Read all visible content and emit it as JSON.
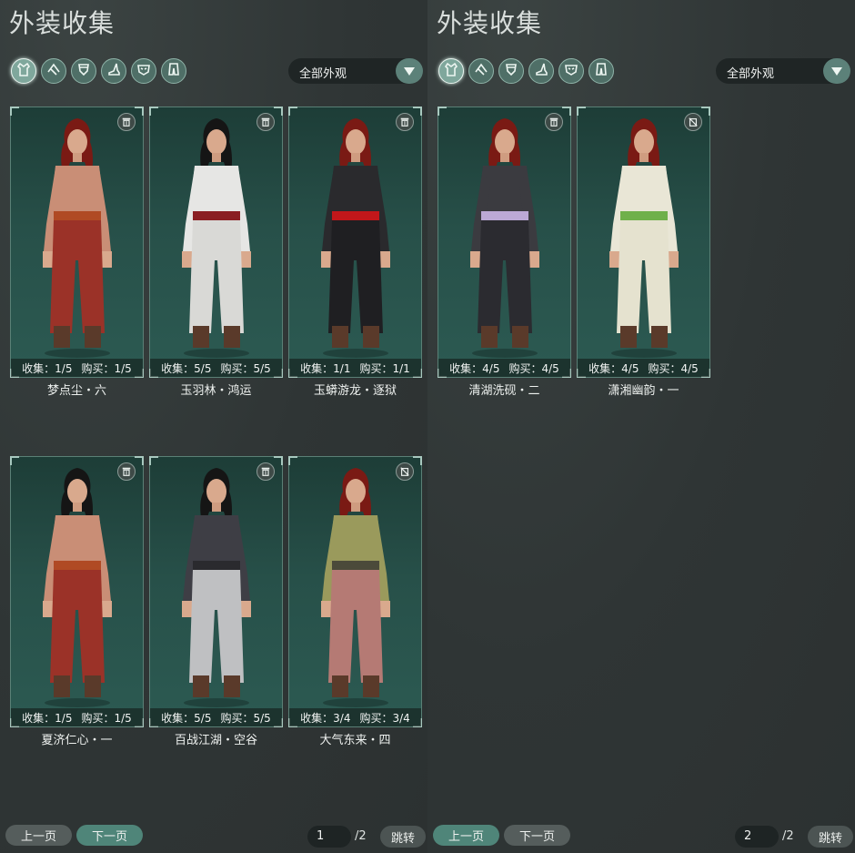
{
  "left": {
    "title": "外装收集",
    "filter": "全部外观",
    "cards": [
      {
        "collect": "收集：1/5",
        "buy": "购买：1/5",
        "name": "梦点尘・六",
        "icon": "trash-icon",
        "colors": {
          "top": "#c98e76",
          "bottom": "#9b3228",
          "belt": "#b04a24",
          "hair": "#7a1a14"
        }
      },
      {
        "collect": "收集：5/5",
        "buy": "购买：5/5",
        "name": "玉羽林・鸿运",
        "icon": "trash-icon",
        "colors": {
          "top": "#e6e6e4",
          "bottom": "#d9d9d6",
          "belt": "#8a1e22",
          "hair": "#151515"
        }
      },
      {
        "collect": "收集：1/1",
        "buy": "购买：1/1",
        "name": "玉蟒游龙・逐狱",
        "icon": "trash-icon",
        "colors": {
          "top": "#2a2a2d",
          "bottom": "#1f1f22",
          "belt": "#c2171a",
          "hair": "#7a1a14"
        }
      },
      {
        "collect": "收集：1/5",
        "buy": "购买：1/5",
        "name": "夏济仁心・一",
        "icon": "trash-icon",
        "colors": {
          "top": "#c98e76",
          "bottom": "#9b3228",
          "belt": "#b04a24",
          "hair": "#151515"
        }
      },
      {
        "collect": "收集：5/5",
        "buy": "购买：5/5",
        "name": "百战江湖・空谷",
        "icon": "trash-icon",
        "colors": {
          "top": "#3e3e45",
          "bottom": "#bfc0c2",
          "belt": "#2a2a2e",
          "hair": "#151515"
        }
      },
      {
        "collect": "收集：3/4",
        "buy": "购买：3/4",
        "name": "大气东来・四",
        "icon": "no-trash-icon",
        "colors": {
          "top": "#9a9a5c",
          "bottom": "#b57a74",
          "belt": "#4b4a3a",
          "hair": "#7a1a14"
        }
      }
    ],
    "prev": "上一页",
    "next": "下一页",
    "page": "1",
    "total": "/2",
    "jump": "跳转"
  },
  "right": {
    "title": "外装收集",
    "filter": "全部外观",
    "cards": [
      {
        "collect": "收集：4/5",
        "buy": "购买：4/5",
        "name": "清湖洗砚・二",
        "icon": "trash-icon",
        "colors": {
          "top": "#3b3b40",
          "bottom": "#2b2b30",
          "belt": "#bca9d6",
          "hair": "#7a1a14"
        }
      },
      {
        "collect": "收集：4/5",
        "buy": "购买：4/5",
        "name": "潇湘幽韵・一",
        "icon": "no-trash-icon",
        "colors": {
          "top": "#e9e6d6",
          "bottom": "#e5e2cf",
          "belt": "#6fb04a",
          "hair": "#7a1a14"
        }
      }
    ],
    "prev": "上一页",
    "next": "下一页",
    "page": "2",
    "total": "/2",
    "jump": "跳转"
  },
  "tab_icons": [
    "robe-icon",
    "hat-icon",
    "armor-icon",
    "boot-icon",
    "mask-icon",
    "pants-icon"
  ]
}
